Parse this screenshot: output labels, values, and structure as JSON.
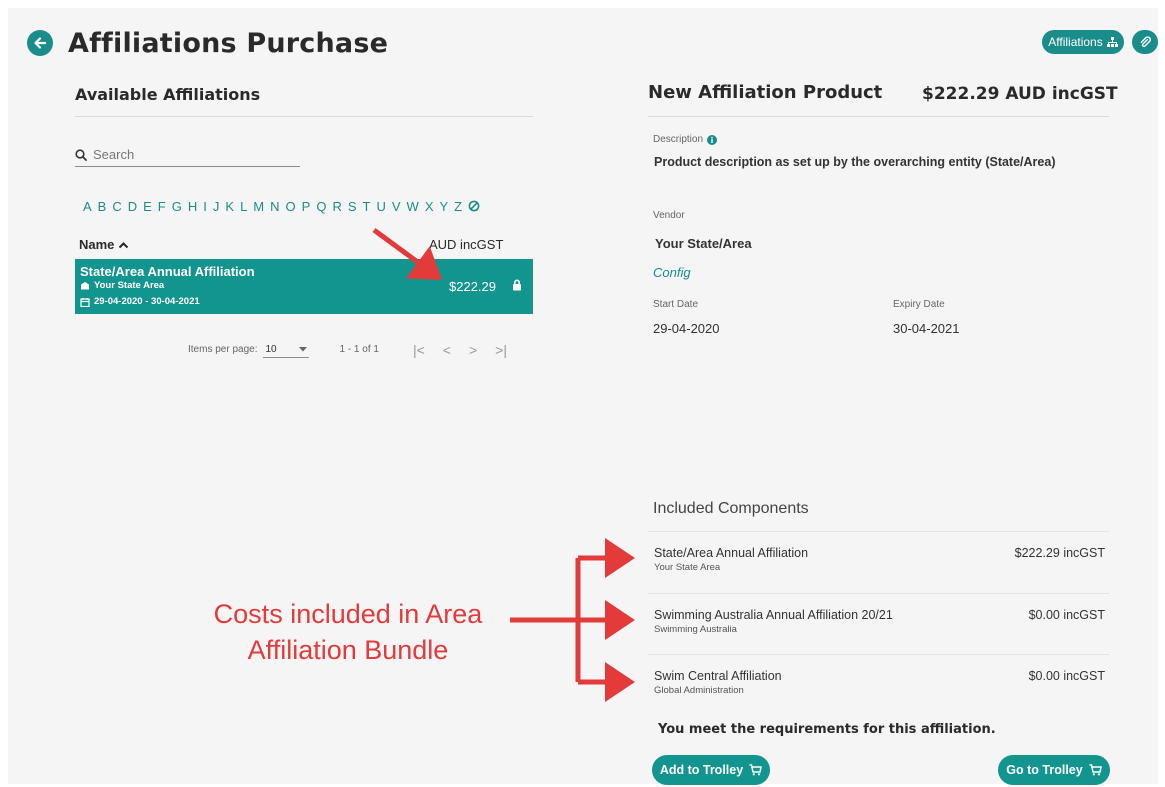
{
  "page": {
    "title": "Affiliations Purchase",
    "header_buttons": {
      "affiliations_label": "Affiliations"
    }
  },
  "left": {
    "heading": "Available Affiliations",
    "search": {
      "placeholder": "Search",
      "value": ""
    },
    "alphabet": [
      "A",
      "B",
      "C",
      "D",
      "E",
      "F",
      "G",
      "H",
      "I",
      "J",
      "K",
      "L",
      "M",
      "N",
      "O",
      "P",
      "Q",
      "R",
      "S",
      "T",
      "U",
      "V",
      "W",
      "X",
      "Y",
      "Z"
    ],
    "columns": {
      "name": "Name",
      "price": "AUD incGST"
    },
    "rows": [
      {
        "title": "State/Area Annual Affiliation",
        "vendor": "Your State Area",
        "dates": "29-04-2020 - 30-04-2021",
        "price": "$222.29"
      }
    ],
    "paginator": {
      "items_per_page_label": "Items per page:",
      "items_per_page": "10",
      "range": "1 - 1 of 1"
    }
  },
  "right": {
    "title": "New Affiliation Product",
    "price": "$222.29 AUD incGST",
    "description_label": "Description",
    "description": "Product description as set up by the overarching entity (State/Area)",
    "vendor_label": "Vendor",
    "vendor": "Your State/Area",
    "config_link": "Config",
    "start_label": "Start Date",
    "start_date": "29-04-2020",
    "expiry_label": "Expiry Date",
    "expiry_date": "30-04-2021",
    "included_title": "Included Components",
    "components": [
      {
        "name": "State/Area Annual Affiliation",
        "sub": "Your State Area",
        "price": "$222.29 incGST"
      },
      {
        "name": "Swimming Australia Annual Affiliation 20/21",
        "sub": "Swimming Australia",
        "price": "$0.00 incGST"
      },
      {
        "name": "Swim Central Affiliation",
        "sub": "Global Administration",
        "price": "$0.00 incGST"
      }
    ],
    "requirements": "You meet the requirements for this affiliation.",
    "add_button": "Add to Trolley",
    "go_button": "Go to Trolley"
  },
  "annotation": {
    "line1": "Costs included in Area",
    "line2": "Affiliation Bundle",
    "color": "#e53a3a"
  },
  "colors": {
    "accent": "#13958f"
  }
}
